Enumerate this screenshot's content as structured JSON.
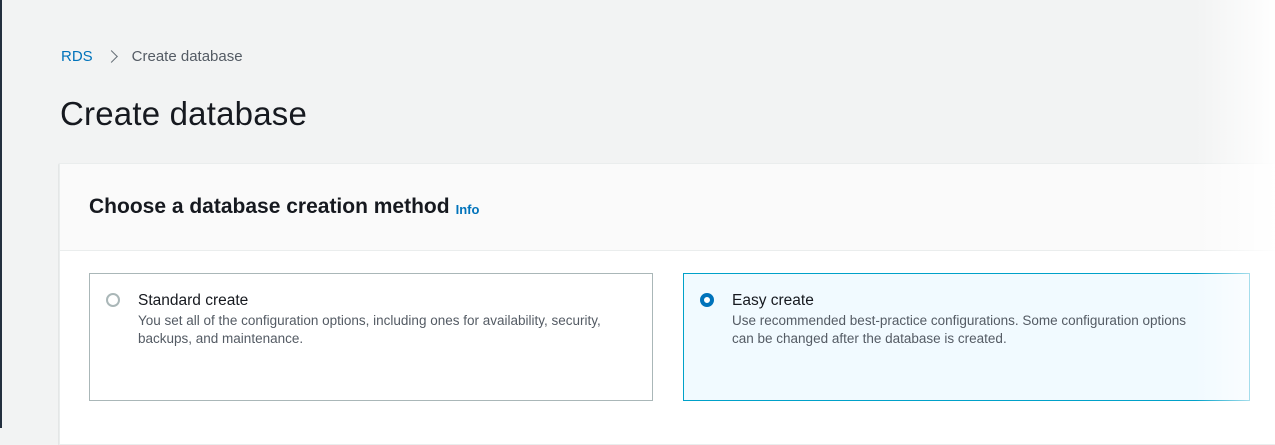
{
  "breadcrumb": {
    "root": "RDS",
    "current": "Create database"
  },
  "page": {
    "title": "Create database"
  },
  "panel": {
    "title": "Choose a database creation method",
    "info_link": "Info"
  },
  "options": [
    {
      "label": "Standard create",
      "description": "You set all of the configuration options, including ones for availability, security, backups, and maintenance.",
      "selected": false
    },
    {
      "label": "Easy create",
      "description": "Use recommended best-practice configurations. Some configuration options can be changed after the database is created.",
      "selected": true
    }
  ],
  "colors": {
    "link": "#0073bb",
    "selected_border": "#00a1c9",
    "selected_bg": "#f1faff",
    "page_bg": "#f2f3f3"
  },
  "icons": {
    "breadcrumb_separator": "chevron-right-icon"
  }
}
